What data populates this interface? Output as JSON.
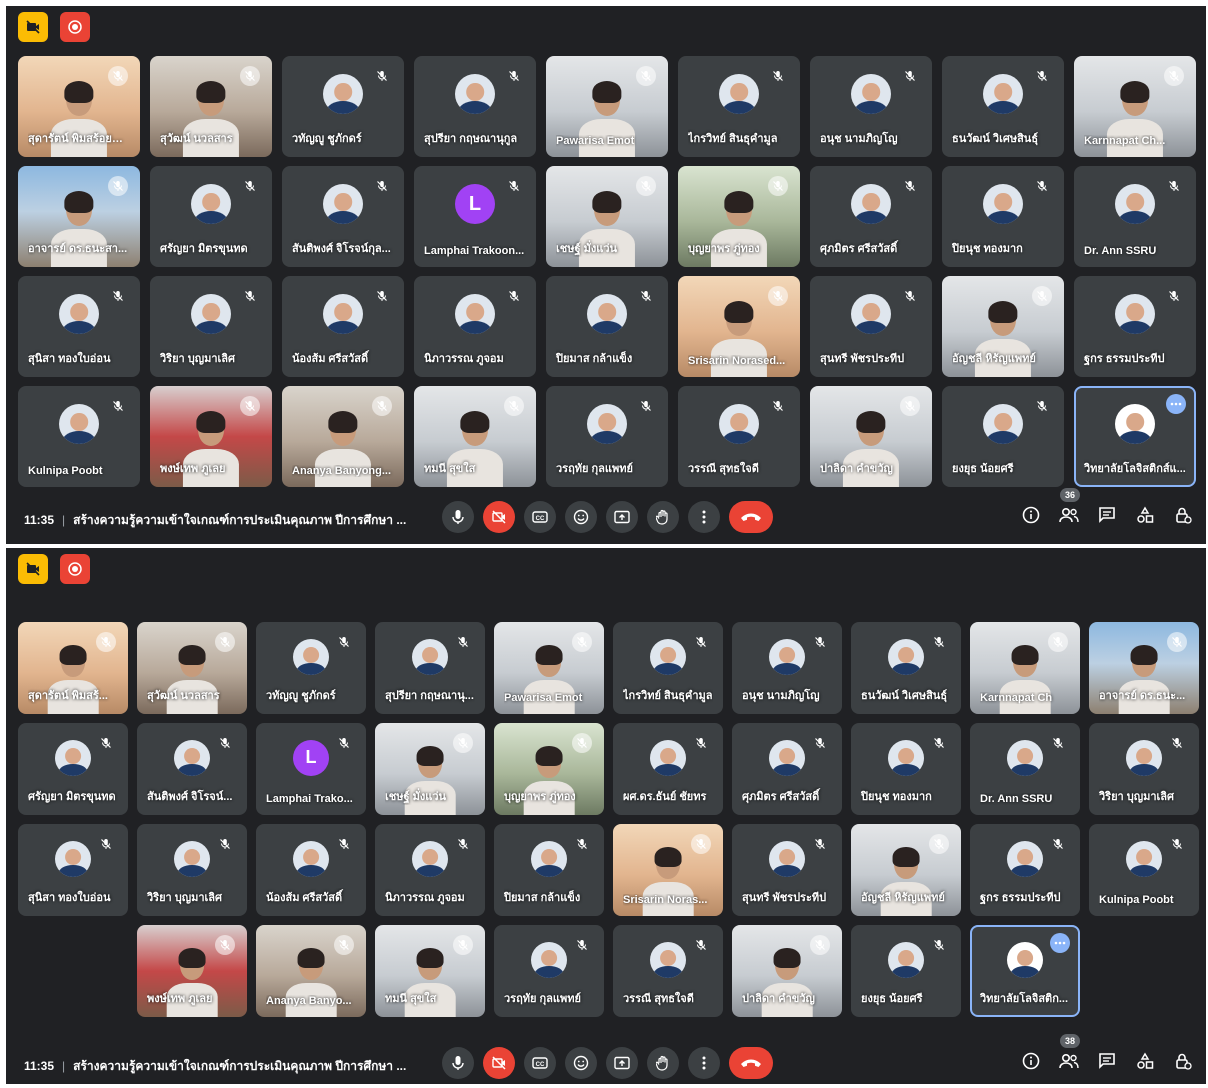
{
  "colors": {
    "background": "#202124",
    "tile": "#3c4043",
    "accent": "#8ab4f8",
    "danger": "#ea4335",
    "recording": "#fbbc04"
  },
  "screens": [
    {
      "participants": [
        {
          "name": "สุดารัตน์ พิมสร้อยทอ...",
          "kind": "photo",
          "bg": "peach"
        },
        {
          "name": "สุวัฒน์ นวลสาร",
          "kind": "photo",
          "bg": "room"
        },
        {
          "name": "วทัญญู ชูภักดร์",
          "kind": "avatar"
        },
        {
          "name": "สุปรียา กฤษณานุกูล",
          "kind": "avatar"
        },
        {
          "name": "Pawarisa Emot",
          "kind": "photo",
          "bg": "office"
        },
        {
          "name": "ไกรวิทย์ สินธุคำมูล",
          "kind": "avatar"
        },
        {
          "name": "อนุช นามภิญโญ",
          "kind": "avatar"
        },
        {
          "name": "ธนวัฒน์ วิเศษสินธุ์",
          "kind": "avatar"
        },
        {
          "name": "Karnnapat Ch...",
          "kind": "photo",
          "bg": "office"
        },
        {
          "name": "อาจารย์ ดร.ธนะสา...",
          "kind": "photo",
          "bg": "sky"
        },
        {
          "name": "ศรัญยา มิตรขุนทด",
          "kind": "avatar"
        },
        {
          "name": "สันติพงศ์ จิโรจน์กุล...",
          "kind": "avatar"
        },
        {
          "name": "Lamphai Trakoon...",
          "kind": "letter",
          "letter": "L"
        },
        {
          "name": "เชษฐ์ มั่งแว่น",
          "kind": "photo",
          "bg": "office"
        },
        {
          "name": "บุญยาพร ภู่ทอง",
          "kind": "photo",
          "bg": "green"
        },
        {
          "name": "ศุภมิตร ศรีสวัสดิ์",
          "kind": "avatar"
        },
        {
          "name": "ปิยนุช ทองมาก",
          "kind": "avatar"
        },
        {
          "name": "Dr. Ann SSRU",
          "kind": "avatar"
        },
        {
          "name": "สุนิสา ทองใบอ่อน",
          "kind": "avatar"
        },
        {
          "name": "วิริยา บุญมาเลิศ",
          "kind": "avatar"
        },
        {
          "name": "น้องส้ม ศรีสวัสดิ์",
          "kind": "avatar"
        },
        {
          "name": "นิภาวรรณ ภูจอม",
          "kind": "avatar"
        },
        {
          "name": "ปิยมาส กล้าแข็ง",
          "kind": "avatar"
        },
        {
          "name": "Srisarin Norased...",
          "kind": "photo",
          "bg": "peach"
        },
        {
          "name": "สุนทรี พัชรประทีป",
          "kind": "avatar"
        },
        {
          "name": "อัญชลี หิรัญแพทย์",
          "kind": "photo",
          "bg": "office"
        },
        {
          "name": "ฐกร ธรรมประทีป",
          "kind": "avatar"
        },
        {
          "name": "Kulnipa Poobt",
          "kind": "avatar"
        },
        {
          "name": "พงษ์เทพ ภูเลย",
          "kind": "photo",
          "bg": "red"
        },
        {
          "name": "Ananya Banyong...",
          "kind": "photo",
          "bg": "room"
        },
        {
          "name": "ทมนี สุขใส",
          "kind": "photo",
          "bg": "office"
        },
        {
          "name": "วรฤทัย กุลแพทย์",
          "kind": "avatar"
        },
        {
          "name": "วรรณี สุทธใจดี",
          "kind": "avatar"
        },
        {
          "name": "ปาลิดา คำขวัญ",
          "kind": "photo",
          "bg": "office"
        },
        {
          "name": "ยงยุธ น้อยศรี",
          "kind": "avatar"
        },
        {
          "name": "วิทยาลัยโลจิสติกส์แ...",
          "kind": "avatar",
          "self": true
        }
      ],
      "bottom": {
        "time": "11:35",
        "title": "สร้างความรู้ความเข้าใจเกณฑ์การประเมินคุณภาพ ปีการศึกษา ...",
        "people_count": "36"
      }
    },
    {
      "participants": [
        {
          "name": "สุดารัตน์ พิมสร้...",
          "kind": "photo",
          "bg": "peach"
        },
        {
          "name": "สุวัฒน์ นวลสาร",
          "kind": "photo",
          "bg": "room"
        },
        {
          "name": "วทัญญู ชูภักดร์",
          "kind": "avatar"
        },
        {
          "name": "สุปรียา กฤษณานุ...",
          "kind": "avatar"
        },
        {
          "name": "Pawarisa Emot",
          "kind": "photo",
          "bg": "office"
        },
        {
          "name": "ไกรวิทย์ สินธุคำมูล",
          "kind": "avatar"
        },
        {
          "name": "อนุช นามภิญโญ",
          "kind": "avatar"
        },
        {
          "name": "ธนวัฒน์ วิเศษสินธุ์",
          "kind": "avatar"
        },
        {
          "name": "Karnnapat Ch",
          "kind": "photo",
          "bg": "office"
        },
        {
          "name": "อาจารย์ ดร.ธนะ...",
          "kind": "photo",
          "bg": "sky"
        },
        {
          "name": "ศรัญยา มิตรขุนทด",
          "kind": "avatar"
        },
        {
          "name": "สันติพงศ์ จิโรจน์...",
          "kind": "avatar"
        },
        {
          "name": "Lamphai Trako...",
          "kind": "letter",
          "letter": "L"
        },
        {
          "name": "เชษฐ์ มั่งแว่น",
          "kind": "photo",
          "bg": "office"
        },
        {
          "name": "บุญยาพร ภู่ทอง",
          "kind": "photo",
          "bg": "green"
        },
        {
          "name": "ผศ.ดร.ธันย์ ชัยทร",
          "kind": "avatar"
        },
        {
          "name": "ศุภมิตร ศรีสวัสดิ์",
          "kind": "avatar"
        },
        {
          "name": "ปิยนุช ทองมาก",
          "kind": "avatar"
        },
        {
          "name": "Dr. Ann SSRU",
          "kind": "avatar"
        },
        {
          "name": "วิริยา บุญมาเลิศ",
          "kind": "avatar"
        },
        {
          "name": "สุนิสา ทองใบอ่อน",
          "kind": "avatar"
        },
        {
          "name": "วิริยา บุญมาเลิศ",
          "kind": "avatar"
        },
        {
          "name": "น้องส้ม ศรีสวัสดิ์",
          "kind": "avatar"
        },
        {
          "name": "นิภาวรรณ ภูจอม",
          "kind": "avatar"
        },
        {
          "name": "ปิยมาส กล้าแข็ง",
          "kind": "avatar"
        },
        {
          "name": "Srisarin Noras...",
          "kind": "photo",
          "bg": "peach"
        },
        {
          "name": "สุนทรี พัชรประทีป",
          "kind": "avatar"
        },
        {
          "name": "อัญชลี หิรัญแพทย์",
          "kind": "photo",
          "bg": "office"
        },
        {
          "name": "ฐกร ธรรมประทีป",
          "kind": "avatar"
        },
        {
          "name": "Kulnipa Poobt",
          "kind": "avatar"
        },
        {
          "name": "",
          "kind": "blank"
        },
        {
          "name": "พงษ์เทพ ภูเลย",
          "kind": "photo",
          "bg": "red"
        },
        {
          "name": "Ananya Banyo...",
          "kind": "photo",
          "bg": "room"
        },
        {
          "name": "ทมนี สุขใส",
          "kind": "photo",
          "bg": "office"
        },
        {
          "name": "วรฤทัย กุลแพทย์",
          "kind": "avatar"
        },
        {
          "name": "วรรณี สุทธใจดี",
          "kind": "avatar"
        },
        {
          "name": "ปาลิดา คำขวัญ",
          "kind": "photo",
          "bg": "office"
        },
        {
          "name": "ยงยุธ น้อยศรี",
          "kind": "avatar"
        },
        {
          "name": "วิทยาลัยโลจิสติก...",
          "kind": "avatar",
          "self": true
        }
      ],
      "bottom": {
        "time": "11:35",
        "title": "สร้างความรู้ความเข้าใจเกณฑ์การประเมินคุณภาพ ปีการศึกษา ...",
        "people_count": "38"
      }
    }
  ],
  "icons": {
    "top": [
      "video-off-badge-icon",
      "record-icon"
    ],
    "controls": [
      "mic-icon",
      "camera-off-icon",
      "captions-icon",
      "emoji-icon",
      "present-icon",
      "raise-hand-icon",
      "more-options-icon",
      "end-call-icon"
    ],
    "right": [
      "info-icon",
      "people-icon",
      "chat-icon",
      "activities-icon",
      "host-controls-icon"
    ]
  }
}
